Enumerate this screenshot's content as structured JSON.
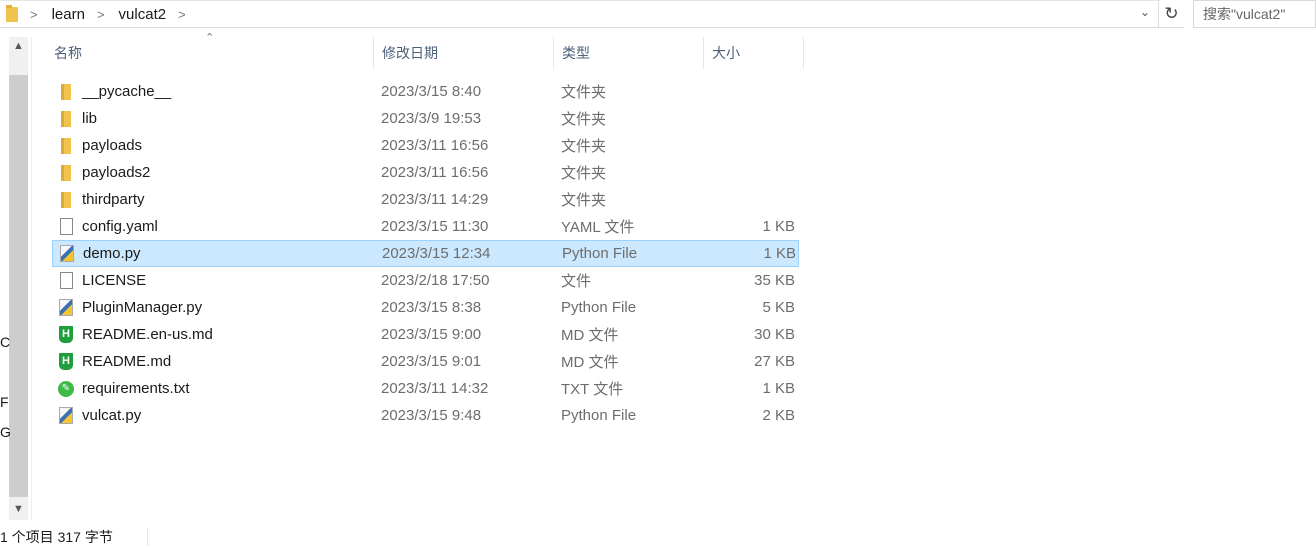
{
  "breadcrumb": [
    "learn",
    "vulcat2"
  ],
  "search": {
    "placeholder": "搜索\"vulcat2\""
  },
  "sidebar_fragments": [
    "C",
    "F",
    "G"
  ],
  "columns": {
    "name": "名称",
    "date": "修改日期",
    "type": "类型",
    "size": "大小"
  },
  "files": [
    {
      "name": "__pycache__",
      "date": "2023/3/15 8:40",
      "type": "文件夹",
      "size": "",
      "icon": "folder"
    },
    {
      "name": "lib",
      "date": "2023/3/9 19:53",
      "type": "文件夹",
      "size": "",
      "icon": "folder"
    },
    {
      "name": "payloads",
      "date": "2023/3/11 16:56",
      "type": "文件夹",
      "size": "",
      "icon": "folder"
    },
    {
      "name": "payloads2",
      "date": "2023/3/11 16:56",
      "type": "文件夹",
      "size": "",
      "icon": "folder"
    },
    {
      "name": "thirdparty",
      "date": "2023/3/11 14:29",
      "type": "文件夹",
      "size": "",
      "icon": "folder"
    },
    {
      "name": "config.yaml",
      "date": "2023/3/15 11:30",
      "type": "YAML 文件",
      "size": "1 KB",
      "icon": "file"
    },
    {
      "name": "demo.py",
      "date": "2023/3/15 12:34",
      "type": "Python File",
      "size": "1 KB",
      "icon": "python",
      "selected": true
    },
    {
      "name": "LICENSE",
      "date": "2023/2/18 17:50",
      "type": "文件",
      "size": "35 KB",
      "icon": "file"
    },
    {
      "name": "PluginManager.py",
      "date": "2023/3/15 8:38",
      "type": "Python File",
      "size": "5 KB",
      "icon": "python"
    },
    {
      "name": "README.en-us.md",
      "date": "2023/3/15 9:00",
      "type": "MD 文件",
      "size": "30 KB",
      "icon": "markdown"
    },
    {
      "name": "README.md",
      "date": "2023/3/15 9:01",
      "type": "MD 文件",
      "size": "27 KB",
      "icon": "markdown"
    },
    {
      "name": "requirements.txt",
      "date": "2023/3/11 14:32",
      "type": "TXT 文件",
      "size": "1 KB",
      "icon": "text"
    },
    {
      "name": "vulcat.py",
      "date": "2023/3/15 9:48",
      "type": "Python File",
      "size": "2 KB",
      "icon": "python"
    }
  ],
  "status": {
    "selection": "1 个项目  317 字节"
  }
}
